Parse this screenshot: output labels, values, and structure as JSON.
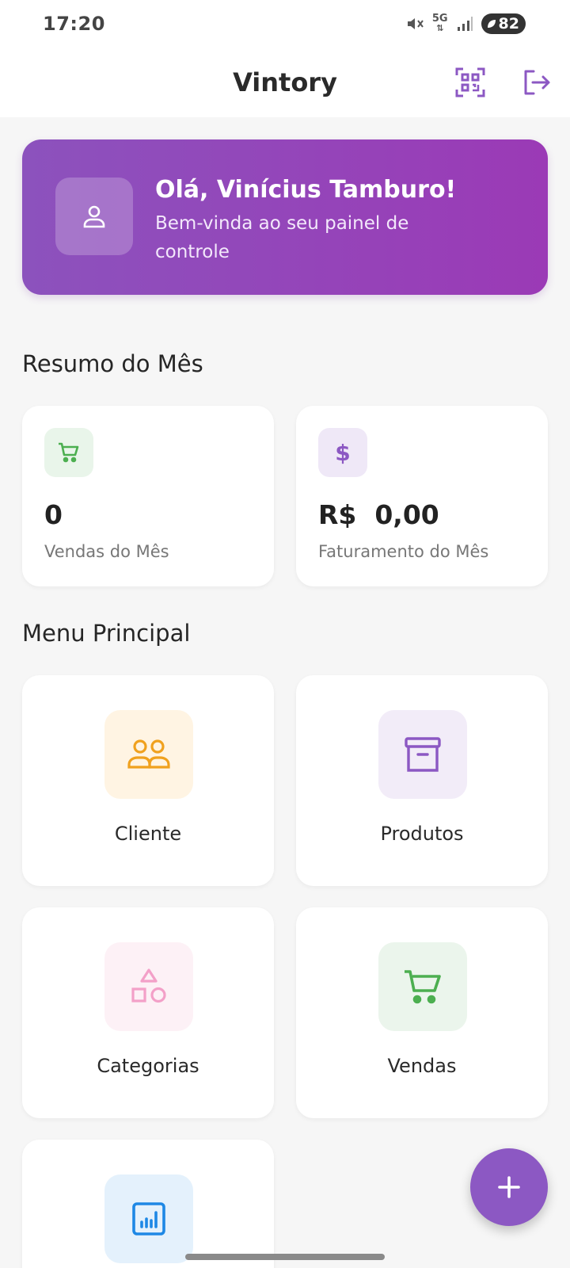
{
  "status_bar": {
    "time": "17:20",
    "network": "5G",
    "battery": "82"
  },
  "app_bar": {
    "title": "Vintory",
    "qr_icon": "qr-code-scan-icon",
    "logout_icon": "logout-icon"
  },
  "banner": {
    "greeting": "Olá, Vinícius Tamburo!",
    "subtitle": "Bem-vinda ao seu painel de controle",
    "icon": "user-icon"
  },
  "summary": {
    "title": "Resumo do Mês",
    "cards": [
      {
        "value": "0",
        "label": "Vendas do Mês",
        "icon": "cart-icon",
        "color": "#4caf50",
        "bg": "#e9f5ea"
      },
      {
        "value": "R$  0,00",
        "label": "Faturamento do Mês",
        "icon": "dollar-icon",
        "color": "#8c58c3",
        "bg": "#efe8f7"
      }
    ]
  },
  "menu": {
    "title": "Menu Principal",
    "items": [
      {
        "label": "Cliente",
        "icon": "people-icon",
        "color": "#f0a11e",
        "bg": "#fff4e3"
      },
      {
        "label": "Produtos",
        "icon": "archive-box-icon",
        "color": "#8c58c3",
        "bg": "#f2ecf8"
      },
      {
        "label": "Categorias",
        "icon": "shapes-icon",
        "color": "#f3a0c8",
        "bg": "#fdf1f6"
      },
      {
        "label": "Vendas",
        "icon": "cart-icon",
        "color": "#4caf50",
        "bg": "#ebf5ec"
      },
      {
        "label": "",
        "icon": "chart-icon",
        "color": "#1e88e5",
        "bg": "#e4f1fc"
      }
    ]
  },
  "fab": {
    "icon": "plus-icon",
    "color": "#8c58c3"
  }
}
